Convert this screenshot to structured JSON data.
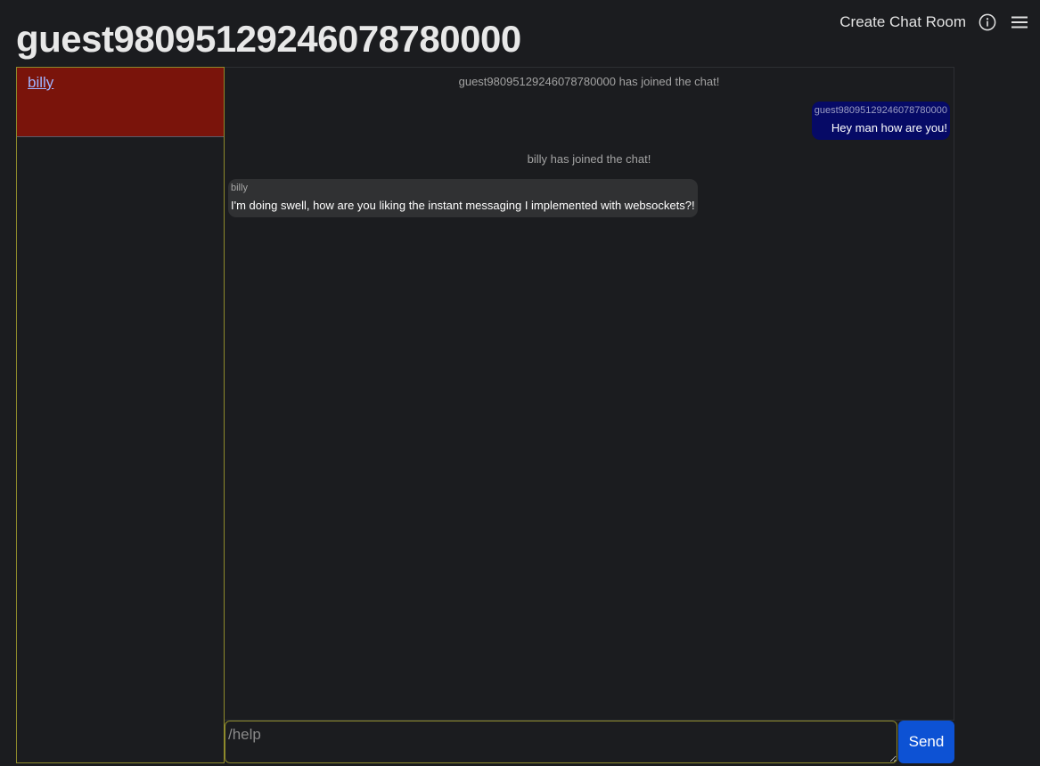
{
  "header": {
    "title": "guest98095129246078780000",
    "create_room_label": "Create Chat Room",
    "info_icon": "info-icon",
    "menu_icon": "hamburger-menu-icon"
  },
  "sidebar": {
    "rooms": [
      {
        "label": "billy"
      }
    ]
  },
  "chat": {
    "messages": [
      {
        "kind": "system",
        "text": "guest98095129246078780000 has joined the chat!"
      },
      {
        "kind": "own",
        "sender": "guest98095129246078780000",
        "text": "Hey man how are you!"
      },
      {
        "kind": "system",
        "text": "billy has joined the chat!"
      },
      {
        "kind": "other",
        "sender": "billy",
        "text": "I'm doing swell, how are you liking the instant messaging I implemented with websockets?!"
      }
    ]
  },
  "composer": {
    "placeholder": "/help",
    "value": "",
    "send_label": "Send"
  },
  "colors": {
    "background": "#1b1c1f",
    "active_room": "#7a140b",
    "own_bubble": "#060a66",
    "other_bubble": "#303133",
    "send_button": "#0d52d4",
    "border_accent": "#8e8a2b"
  }
}
